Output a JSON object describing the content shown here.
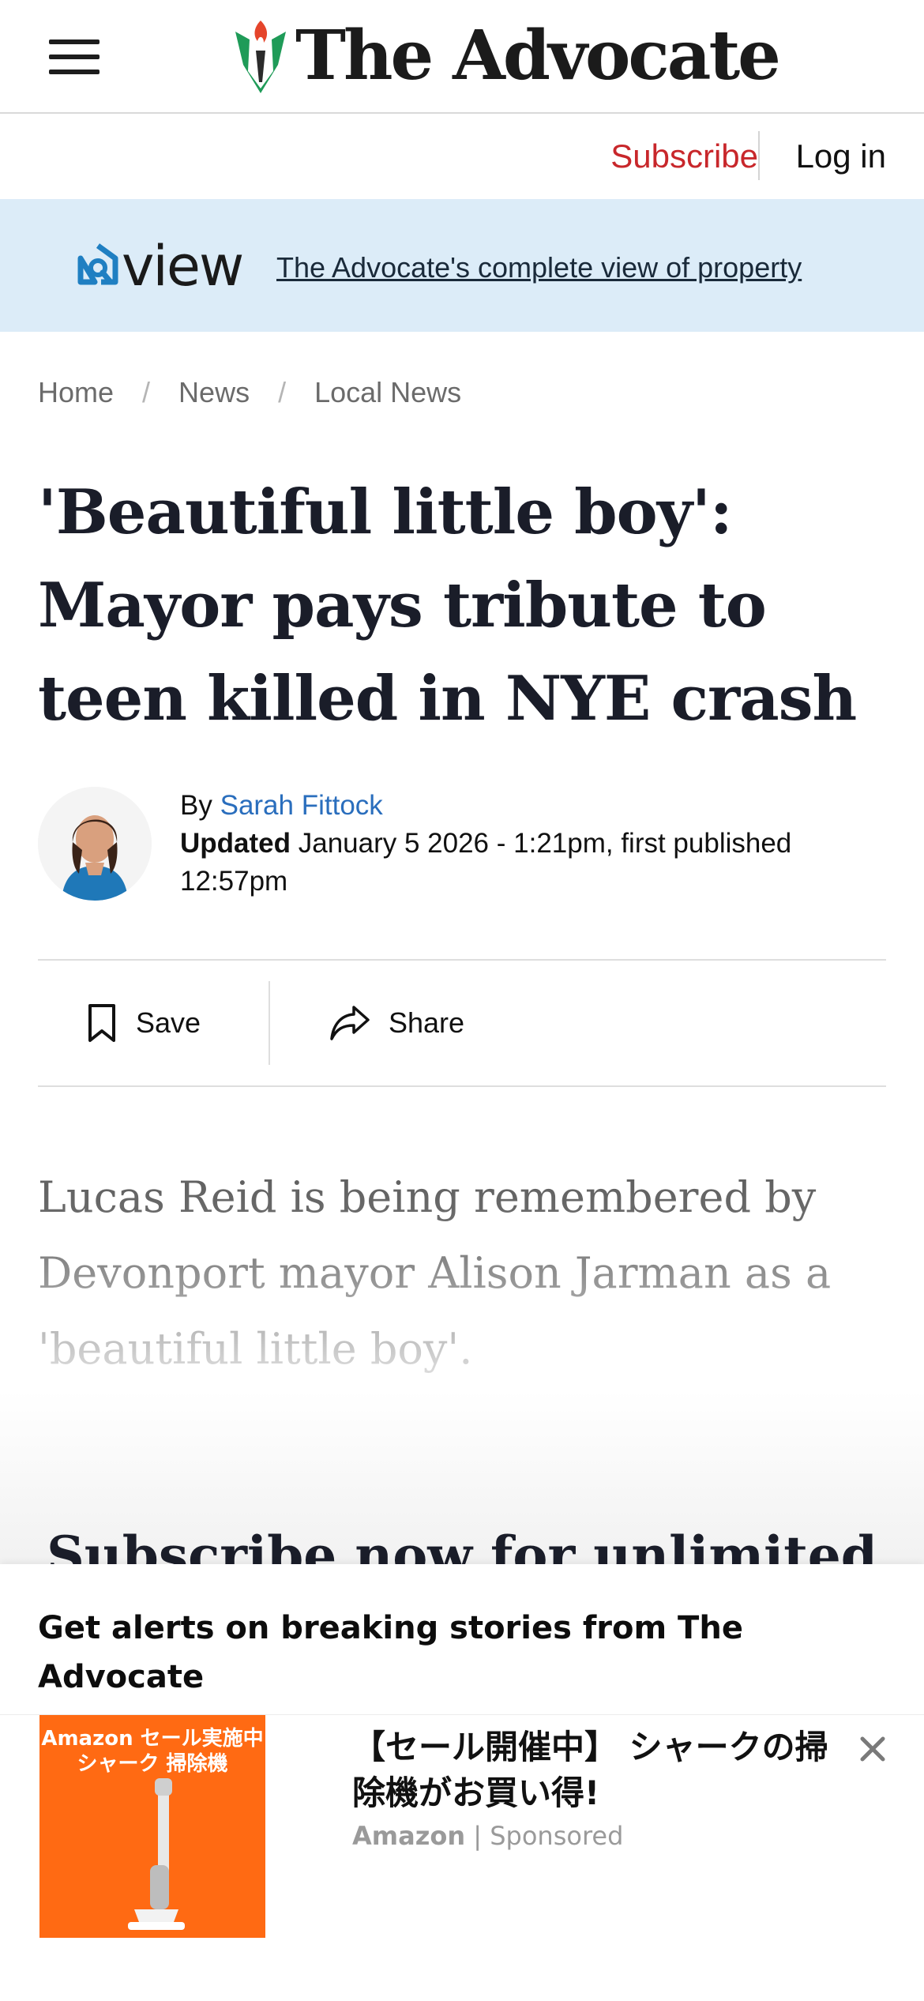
{
  "header": {
    "logo_text": "The Advocate",
    "menu_icon": "hamburger-menu-icon",
    "subscribe_label": "Subscribe",
    "login_label": "Log in",
    "subscribe_color": "#c8272b"
  },
  "promo": {
    "brand_word": "view",
    "link_text": "The Advocate's complete view of property",
    "background": "#dcecf8"
  },
  "breadcrumb": [
    "Home",
    "News",
    "Local News"
  ],
  "article": {
    "headline": "'Beautiful little boy': Mayor pays tribute to teen killed in NYE crash",
    "by_prefix": "By",
    "author": "Sarah Fittock",
    "updated_label": "Updated",
    "date_text": "January 5 2026 - 1:21pm, first published 12:57pm",
    "lede": "Lucas Reid is being remembered by Devonport mayor Alison Jarman as a 'beautiful little boy'."
  },
  "actions": {
    "save_label": "Save",
    "share_label": "Share"
  },
  "paywall": {
    "heading": "Subscribe now for unlimited"
  },
  "alert": {
    "text": "Get alerts on breaking stories from The Advocate"
  },
  "ad": {
    "image_caption_line1": "Amazon セール実施中",
    "image_caption_line2": "シャーク 掃除機",
    "title": "【セール開催中】 シャークの掃除機がお買い得!",
    "advertiser": "Amazon",
    "separator": "|",
    "sponsored_label": "Sponsored"
  }
}
